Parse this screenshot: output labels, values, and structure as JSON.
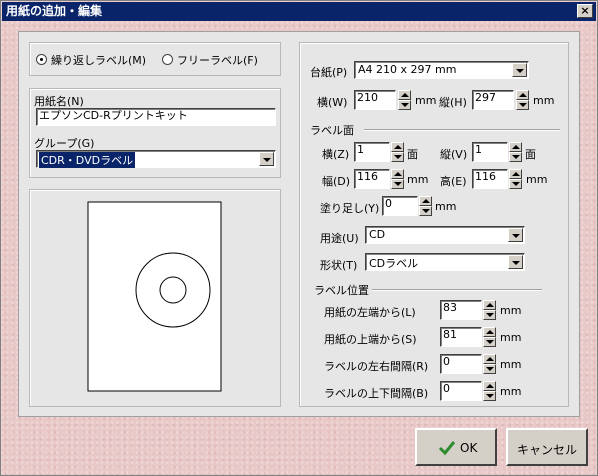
{
  "window": {
    "title": "用紙の追加・編集",
    "close_glyph": "×"
  },
  "label_type": {
    "options": [
      {
        "label": "繰り返しラベル(M)",
        "selected": true
      },
      {
        "label": "フリーラベル(F)",
        "selected": false
      }
    ]
  },
  "paper_name": {
    "label": "用紙名(N)",
    "value": "エプソンCD-Rプリントキット"
  },
  "group": {
    "label": "グループ(G)",
    "value": "CDR・DVDラベル"
  },
  "base_paper": {
    "label": "台紙(P)",
    "value": "A4 210 x 297 mm"
  },
  "width": {
    "label": "横(W)",
    "value": "210",
    "unit": "mm"
  },
  "height": {
    "label": "縦(H)",
    "value": "297",
    "unit": "mm"
  },
  "label_face": {
    "heading": "ラベル面",
    "cols": {
      "label": "横(Z)",
      "value": "1",
      "unit": "面"
    },
    "rows": {
      "label": "縦(V)",
      "value": "1",
      "unit": "面"
    },
    "lwidth": {
      "label": "幅(D)",
      "value": "116",
      "unit": "mm"
    },
    "lheight": {
      "label": "高(E)",
      "value": "116",
      "unit": "mm"
    },
    "bleed": {
      "label": "塗り足し(Y)",
      "value": "0",
      "unit": "mm"
    },
    "usage": {
      "label": "用途(U)",
      "value": "CD"
    },
    "shape": {
      "label": "形状(T)",
      "value": "CDラベル"
    }
  },
  "label_position": {
    "heading": "ラベル位置",
    "left": {
      "label": "用紙の左端から(L)",
      "value": "83",
      "unit": "mm"
    },
    "top": {
      "label": "用紙の上端から(S)",
      "value": "81",
      "unit": "mm"
    },
    "hgap": {
      "label": "ラベルの左右間隔(R)",
      "value": "0",
      "unit": "mm"
    },
    "vgap": {
      "label": "ラベルの上下間隔(B)",
      "value": "0",
      "unit": "mm"
    }
  },
  "buttons": {
    "ok": "OK",
    "cancel": "キャンセル"
  },
  "colors": {
    "titlebar": "#0a246a",
    "panel": "#e6e6e6",
    "background": "#e9c8c8",
    "ok_check": "#2e8b2e"
  }
}
